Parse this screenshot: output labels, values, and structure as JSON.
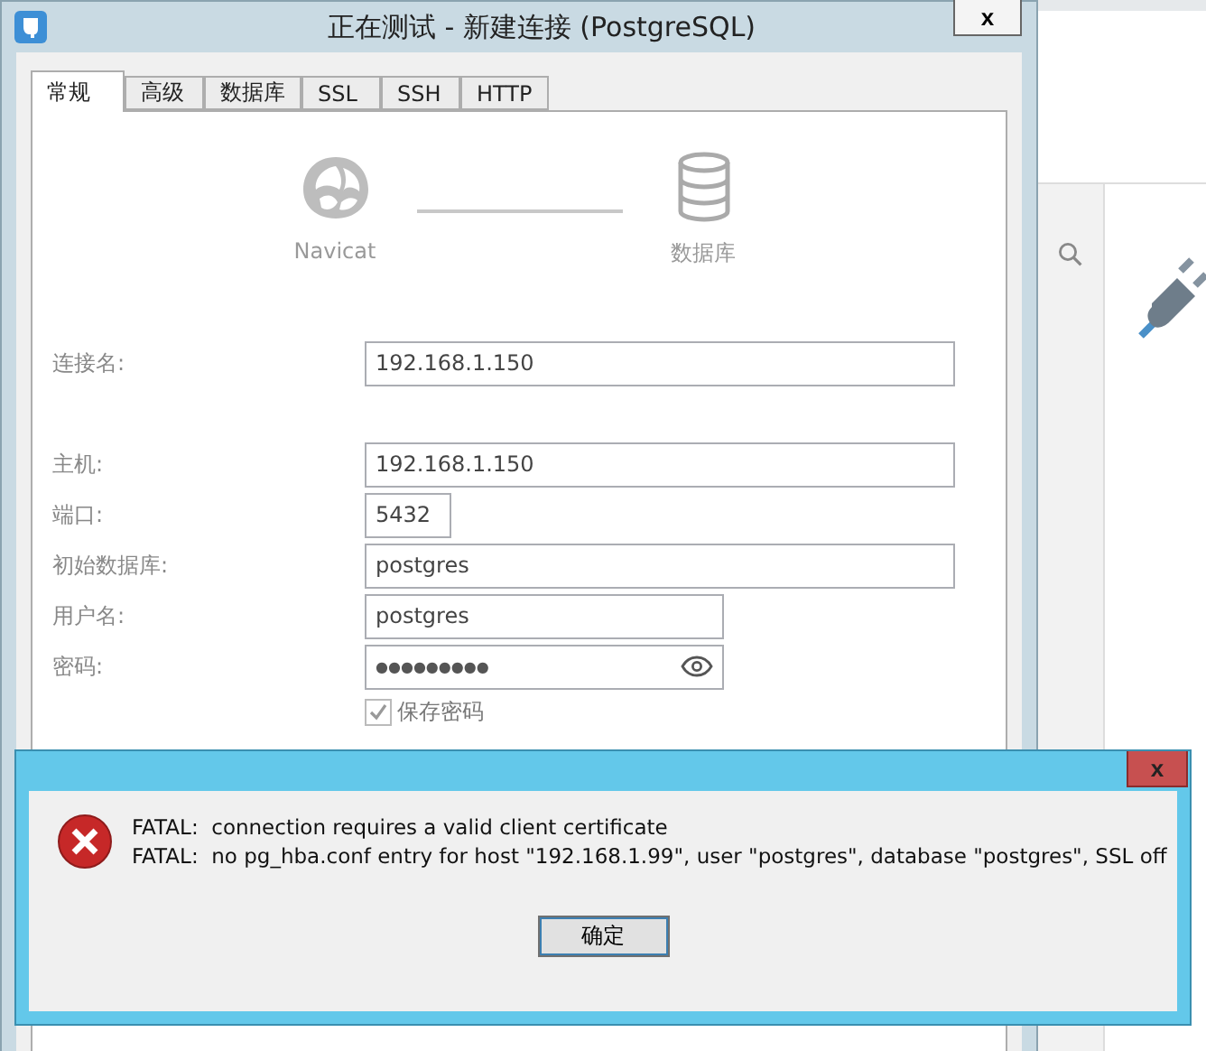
{
  "window": {
    "title": "正在测试 - 新建连接 (PostgreSQL)",
    "close": "x"
  },
  "tabs": [
    {
      "label": "常规",
      "selected": true
    },
    {
      "label": "高级",
      "selected": false
    },
    {
      "label": "数据库",
      "selected": false
    },
    {
      "label": "SSL",
      "selected": false
    },
    {
      "label": "SSH",
      "selected": false
    },
    {
      "label": "HTTP",
      "selected": false
    }
  ],
  "diagram": {
    "left_label": "Navicat",
    "right_label": "数据库"
  },
  "fields": [
    {
      "label": "连接名:",
      "value": "192.168.1.150",
      "kind": "text"
    },
    {
      "label": "主机:",
      "value": "192.168.1.150",
      "kind": "text"
    },
    {
      "label": "端口:",
      "value": "5432",
      "kind": "text"
    },
    {
      "label": "初始数据库:",
      "value": "postgres",
      "kind": "text"
    },
    {
      "label": "用户名:",
      "value": "postgres",
      "kind": "text"
    },
    {
      "label": "密码:",
      "value": "●●●●●●●●●",
      "kind": "password"
    }
  ],
  "save_password": {
    "label": "保存密码",
    "checked": true,
    "disabled": true
  },
  "error_dialog": {
    "close": "x",
    "lines": [
      "FATAL:  connection requires a valid client certificate",
      "FATAL:  no pg_hba.conf entry for host \"192.168.1.99\", user \"postgres\", database \"postgres\", SSL off"
    ],
    "button": "确定"
  }
}
